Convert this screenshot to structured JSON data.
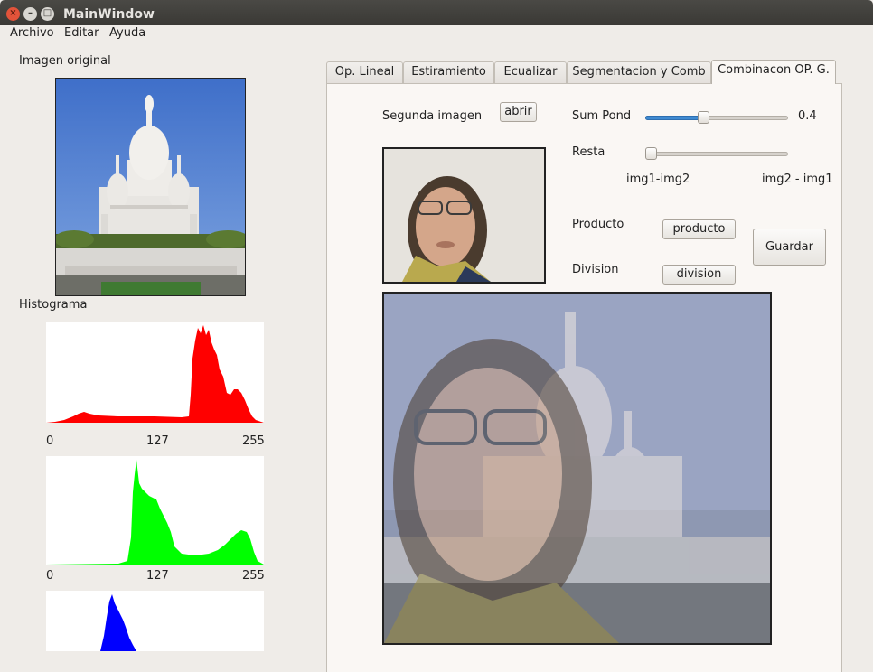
{
  "window": {
    "title": "MainWindow"
  },
  "menu": [
    "Archivo",
    "Editar",
    "Ayuda"
  ],
  "left": {
    "original_label": "Imagen original",
    "histogram_label": "Histograma",
    "histograms": [
      {
        "name": "red",
        "color": "#ff0000",
        "ticks": [
          "0",
          "127",
          "255"
        ]
      },
      {
        "name": "green",
        "color": "#00ff00",
        "ticks": [
          "0",
          "127",
          "255"
        ]
      },
      {
        "name": "blue",
        "color": "#0000ff"
      }
    ]
  },
  "tabs": [
    "Op. Lineal",
    "Estiramiento",
    "Ecualizar",
    "Segmentacion y Comb",
    "Combinacon OP. G."
  ],
  "active_tab": 4,
  "panel": {
    "second_image_label": "Segunda imagen",
    "open_button": "abrir",
    "sum_label": "Sum Pond",
    "sum_value": 0.4,
    "sum_value_text": "0.4",
    "resta_label": "Resta",
    "resta_value": 0,
    "resta_left": "img1-img2",
    "resta_right": "img2 - img1",
    "product_label": "Producto",
    "product_button": "producto",
    "division_label": "Division",
    "division_button": "division",
    "save_button": "Guardar"
  }
}
